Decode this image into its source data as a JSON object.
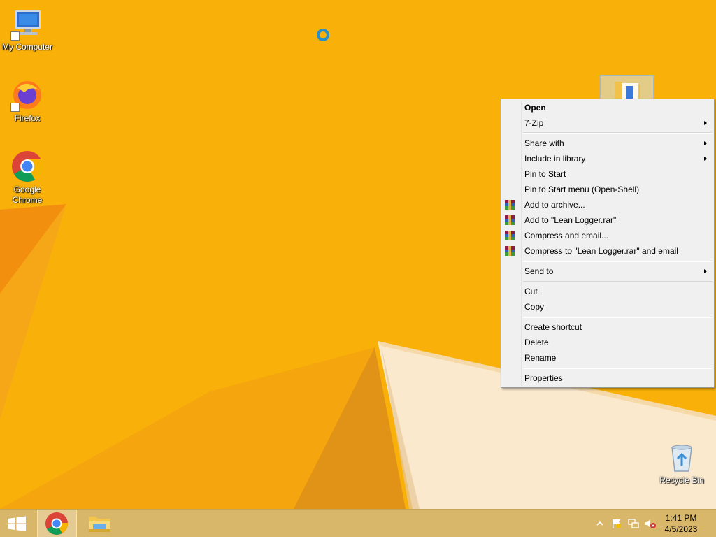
{
  "desktop": {
    "icons": [
      {
        "label": "My Computer",
        "icon": "my-computer-icon"
      },
      {
        "label": "Firefox",
        "icon": "firefox-icon"
      },
      {
        "label": "Google Chrome",
        "icon": "chrome-icon"
      },
      {
        "label": "Recycle Bin",
        "icon": "recycle-bin-icon"
      }
    ],
    "selected_item": {
      "icon": "folder-icon"
    }
  },
  "context_menu": {
    "items": [
      {
        "label": "Open",
        "bold": true
      },
      {
        "label": "7-Zip",
        "submenu": true
      },
      {
        "label": "Share with",
        "submenu": true
      },
      {
        "label": "Include in library",
        "submenu": true
      },
      {
        "label": "Pin to Start"
      },
      {
        "label": "Pin to Start menu (Open-Shell)"
      },
      {
        "label": "Add to archive...",
        "icon": "winrar-icon"
      },
      {
        "label": "Add to \"Lean Logger.rar\"",
        "icon": "winrar-icon"
      },
      {
        "label": "Compress and email...",
        "icon": "winrar-icon"
      },
      {
        "label": "Compress to \"Lean Logger.rar\" and email",
        "icon": "winrar-icon"
      },
      {
        "label": "Send to",
        "submenu": true
      },
      {
        "label": "Cut"
      },
      {
        "label": "Copy"
      },
      {
        "label": "Create shortcut"
      },
      {
        "label": "Delete"
      },
      {
        "label": "Rename"
      },
      {
        "label": "Properties"
      }
    ]
  },
  "taskbar": {
    "start_icon": "windows-logo-icon",
    "pinned": [
      {
        "name": "Google Chrome",
        "icon": "chrome-icon",
        "active": true
      },
      {
        "name": "File Explorer",
        "icon": "file-explorer-icon",
        "active": false
      }
    ],
    "tray": {
      "icons": [
        "show-hidden-icons-chevron",
        "action-center-flag-icon",
        "network-icon",
        "volume-muted-icon"
      ],
      "time": "1:41 PM",
      "date": "4/5/2023"
    }
  },
  "colors": {
    "wallpaper": "#f9b10a",
    "menu_bg": "#f0f0f0",
    "taskbar": "#d9b76a"
  }
}
